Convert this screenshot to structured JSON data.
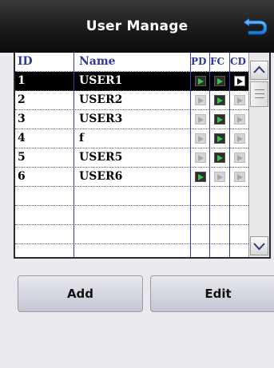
{
  "header": {
    "title": "User Manage",
    "back_icon": "back-arrow-icon"
  },
  "table": {
    "columns": {
      "id": "ID",
      "name": "Name",
      "pd": "PD",
      "fc": "FC",
      "cd": "CD"
    },
    "rows": [
      {
        "id": "1",
        "name": "USER1",
        "pd": true,
        "fc": true,
        "cd": true,
        "selected": true
      },
      {
        "id": "2",
        "name": "USER2",
        "pd": false,
        "fc": true,
        "cd": false,
        "selected": false
      },
      {
        "id": "3",
        "name": "USER3",
        "pd": false,
        "fc": true,
        "cd": false,
        "selected": false
      },
      {
        "id": "4",
        "name": "f",
        "pd": false,
        "fc": true,
        "cd": false,
        "selected": false
      },
      {
        "id": "5",
        "name": "USER5",
        "pd": false,
        "fc": true,
        "cd": false,
        "selected": false
      },
      {
        "id": "6",
        "name": "USER6",
        "pd": true,
        "fc": false,
        "cd": false,
        "selected": false
      }
    ],
    "empty_rows": 3
  },
  "colors": {
    "header_bg": "#1b1b1b",
    "column_header": "#2a3aa0",
    "perm_on": "#39c04a",
    "perm_off": "#a8a8a8"
  },
  "buttons": {
    "add": "Add",
    "edit": "Edit"
  }
}
